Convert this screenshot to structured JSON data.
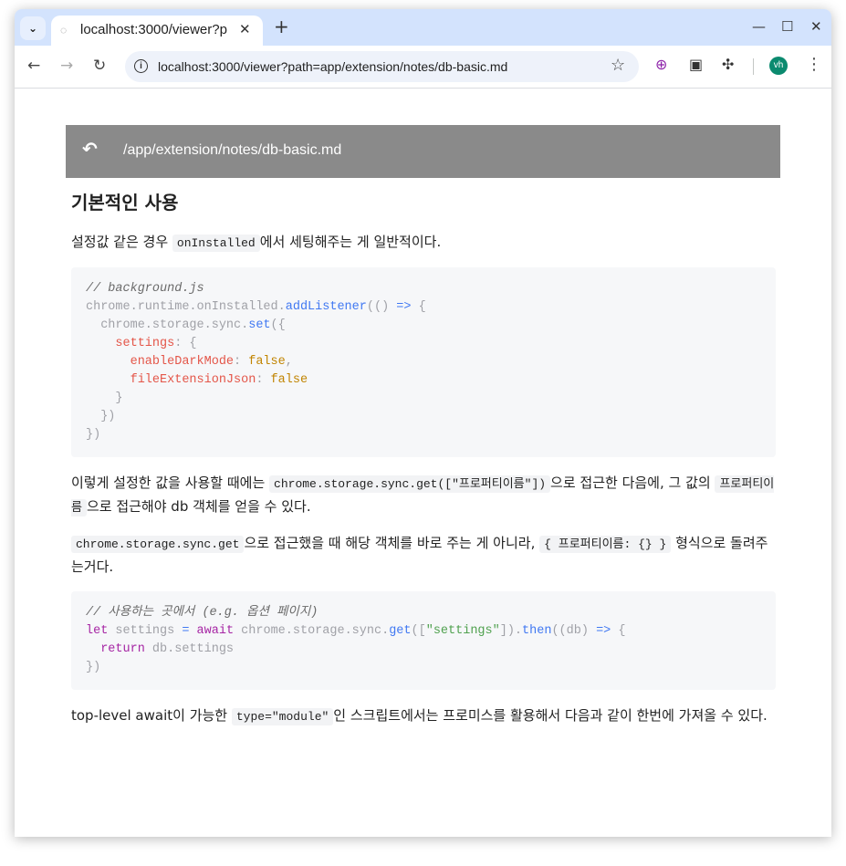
{
  "browser": {
    "tab_title": "localhost:3000/viewer?p",
    "tab_close": "✕",
    "new_tab": "+",
    "minimize": "—",
    "maximize": "☐",
    "close": "✕",
    "url": "localhost:3000/viewer?path=app/extension/notes/db-basic.md",
    "avatar_initials": "vh"
  },
  "viewer": {
    "path": "/app/extension/notes/db-basic.md"
  },
  "doc": {
    "heading": "기본적인 사용",
    "p1_a": "설정값 같은 경우 ",
    "p1_code": "onInstalled",
    "p1_b": "에서 세팅해주는 게 일반적이다.",
    "code1": {
      "l1_comment": "// background.js",
      "l2_a": "chrome.runtime.onInstalled.",
      "l2_fn": "addListener",
      "l2_b": "(() ",
      "l2_arrow": "=>",
      "l2_c": " {",
      "l3_a": "  chrome.storage.sync.",
      "l3_fn": "set",
      "l3_b": "({",
      "l4_prop": "    settings",
      "l4_b": ": {",
      "l5_prop": "      enableDarkMode",
      "l5_b": ": ",
      "l5_val": "false",
      "l5_c": ",",
      "l6_prop": "      fileExtensionJson",
      "l6_b": ": ",
      "l6_val": "false",
      "l7": "    }",
      "l8": "  })",
      "l9": "})"
    },
    "p2_a": "이렇게 설정한 값을 사용할 때에는 ",
    "p2_code1": "chrome.storage.sync.get([\"프로퍼티이름\"])",
    "p2_b": "으로 접근한 다음에, 그 값의 ",
    "p2_code2": "프로퍼티이름",
    "p2_c": "으로 접근해야 db 객체를 얻을 수 있다.",
    "p3_code1": "chrome.storage.sync.get",
    "p3_a": "으로 접근했을 때 해당 객체를 바로 주는 게 아니라, ",
    "p3_code2": "{ 프로퍼티이름: {} }",
    "p3_b": " 형식으로 돌려주는거다.",
    "code2": {
      "l1_comment": "// 사용하는 곳에서 (e.g. 옵션 페이지)",
      "l2_kw1": "let",
      "l2_a": " settings ",
      "l2_eq": "=",
      "l2_sp": " ",
      "l2_kw2": "await",
      "l2_b": " chrome.storage.sync.",
      "l2_fn1": "get",
      "l2_c": "([",
      "l2_str": "\"settings\"",
      "l2_d": "]).",
      "l2_fn2": "then",
      "l2_e": "((db) ",
      "l2_arrow": "=>",
      "l2_f": " {",
      "l3_kw": "  return",
      "l3_a": " db.settings",
      "l4": "})"
    },
    "p4_a": "top-level await이 가능한 ",
    "p4_code": "type=\"module\"",
    "p4_b": "인 스크립트에서는 프로미스를 활용해서 다음과 같이 한번에 가져올 수 있다."
  }
}
